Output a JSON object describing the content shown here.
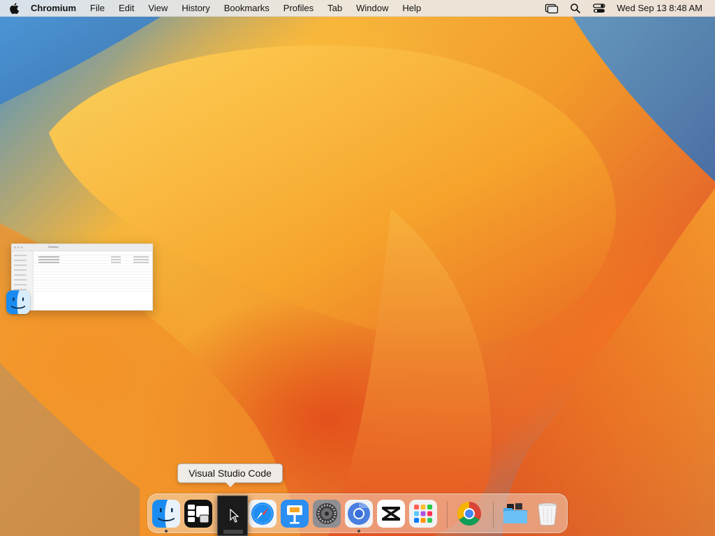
{
  "menubar": {
    "app_name": "Chromium",
    "items": [
      "File",
      "Edit",
      "View",
      "History",
      "Bookmarks",
      "Profiles",
      "Tab",
      "Window",
      "Help"
    ],
    "status_icons": [
      "screen-mirroring-icon",
      "search-icon",
      "control-center-icon"
    ],
    "clock": "Wed Sep 13  8:48 AM"
  },
  "finder_window": {
    "title": "Desktop"
  },
  "tooltip": {
    "text": "Visual Studio Code"
  },
  "dock": {
    "items": [
      {
        "name": "Finder",
        "icon": "finder-icon",
        "running": true
      },
      {
        "name": "Stage Manager",
        "icon": "stage-manager-icon",
        "running": false
      },
      {
        "name": "Visual Studio Code",
        "icon": "vscode-icon",
        "running": false
      },
      {
        "name": "Safari",
        "icon": "safari-icon",
        "running": false
      },
      {
        "name": "Keynote",
        "icon": "keynote-icon",
        "running": false
      },
      {
        "name": "System Settings",
        "icon": "settings-icon",
        "running": false
      },
      {
        "name": "Chromium",
        "icon": "chromium-icon",
        "running": true
      },
      {
        "name": "CapCut",
        "icon": "capcut-icon",
        "running": false
      },
      {
        "name": "Launchpad",
        "icon": "launchpad-icon",
        "running": false
      },
      {
        "name": "Google Chrome",
        "icon": "chrome-icon",
        "running": false
      },
      {
        "name": "Downloads",
        "icon": "folder-icon",
        "running": false
      },
      {
        "name": "Trash",
        "icon": "trash-icon",
        "running": false
      }
    ]
  },
  "colors": {
    "accent_orange": "#f29a2a",
    "accent_blue": "#3f8fd2",
    "menubar_bg": "#ececee"
  }
}
